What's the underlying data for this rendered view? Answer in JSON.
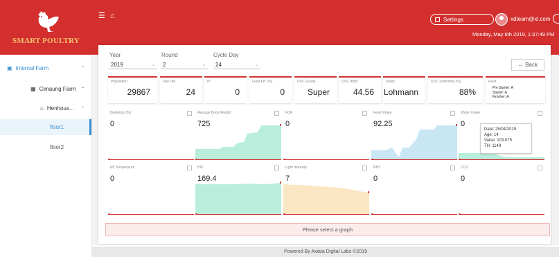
{
  "brand": {
    "name_part1": "SMART ",
    "name_part2": "POULTRY"
  },
  "header": {
    "menu_icon": "hamburger-icon",
    "home_icon": "home-icon",
    "settings_label": "Settings",
    "user_email": "xdteam@xl.com",
    "datetime": "Monday, May 6th 2019, 1:37:49 PM"
  },
  "sidebar": {
    "items": [
      {
        "label": "Internal Farm",
        "icon": "farm-icon",
        "color": "#3a8fd0"
      },
      {
        "label": "Cimaung Farm",
        "icon": "grid-icon",
        "color": "#333333"
      },
      {
        "label": "Henhous...",
        "icon": "home-icon",
        "color": "#333333"
      },
      {
        "label": "floor1",
        "active": true,
        "color": "#3a8fd0"
      },
      {
        "label": "floor2",
        "color": "#555555"
      }
    ]
  },
  "filters": {
    "year_label": "Year",
    "year_value": "2019",
    "round_label": "Round",
    "round_value": "2",
    "cycle_label": "Cycle Day",
    "cycle_value": "24",
    "back_label": "← Back"
  },
  "stats": [
    {
      "label": "Population",
      "value": "29867"
    },
    {
      "label": "Day Old",
      "value": "24"
    },
    {
      "label": "IP",
      "value": "0"
    },
    {
      "label": "Feed Eff. (%)",
      "value": "0"
    },
    {
      "label": "DOC Grade",
      "value": "Super"
    },
    {
      "label": "DOC ABW",
      "value": "44.56"
    },
    {
      "label": "Strain",
      "value": "Lohmann"
    },
    {
      "label": "DOC uniformity (%)",
      "value": "88%"
    },
    {
      "label": "Feed",
      "lines": [
        "Pre Starter: A",
        "Starter: A",
        "Finisher: A"
      ]
    }
  ],
  "graphs": [
    {
      "label": "Depletion (%)",
      "value": "0",
      "fill": ""
    },
    {
      "label": "Average Body Weight",
      "value": "725",
      "fill": "#b9eddc"
    },
    {
      "label": "FCR",
      "value": "0",
      "fill": ""
    },
    {
      "label": "Feed Intake",
      "value": "92.25",
      "fill": "#c9e6f5"
    },
    {
      "label": "Water Intake",
      "value": "0",
      "fill": "#b9eddc"
    },
    {
      "label": "Eff Temperature",
      "value": "0",
      "fill": ""
    },
    {
      "label": "IHS",
      "value": "169.4",
      "fill": "#b9eddc"
    },
    {
      "label": "Light Intensity",
      "value": "7",
      "fill": "#fbe6c4"
    },
    {
      "label": "NH3",
      "value": "0",
      "fill": ""
    },
    {
      "label": "CO2",
      "value": "0",
      "fill": ""
    }
  ],
  "tooltip": {
    "line1": "Date: 25/04/2019",
    "line2": "Age: 14",
    "line3": "Value: 103.075",
    "line4": "TH: 1149"
  },
  "message": "Please select a graph",
  "footer": "Powered By Axiata Digital Labs ©2019"
}
